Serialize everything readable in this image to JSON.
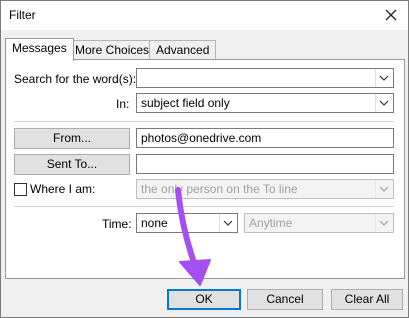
{
  "window": {
    "title": "Filter"
  },
  "tabs": [
    {
      "label": "Messages",
      "active": true
    },
    {
      "label": "More Choices",
      "active": false
    },
    {
      "label": "Advanced",
      "active": false
    }
  ],
  "messages": {
    "search_label": "Search for the word(s):",
    "search_value": "",
    "in_label": "In:",
    "in_value": "subject field only",
    "from_button": "From...",
    "from_value": "photos@onedrive.com",
    "sent_to_button": "Sent To...",
    "sent_to_value": "",
    "where_label": "Where I am:",
    "where_checked": false,
    "where_value": "the only person on the To line",
    "time_label": "Time:",
    "time_value": "none",
    "time_range_value": "Anytime"
  },
  "footer": {
    "ok": "OK",
    "cancel": "Cancel",
    "clear_all": "Clear All"
  },
  "colors": {
    "annotation_arrow": "#a64ff0",
    "primary_border": "#0078d7"
  },
  "icons": {
    "close": "close-icon",
    "dropdown": "chevron-down-icon"
  }
}
